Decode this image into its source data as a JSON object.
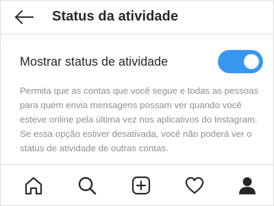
{
  "header": {
    "back_icon": "arrow-left-icon",
    "title": "Status da atividade"
  },
  "setting": {
    "label": "Mostrar status de atividade",
    "enabled": true,
    "toggle_color": "#3897f0",
    "description": "Permita que as contas que você segue e todas as pessoas\npara quem envia mensagens possam ver quando você\nesteve online pela última vez nos aplicativos do Instagram.\nSe essa opção estiver desativada, você não poderá ver o\nstatus de atividade de outras contas."
  },
  "bottom_nav": {
    "items": [
      {
        "icon": "home-icon"
      },
      {
        "icon": "search-icon"
      },
      {
        "icon": "add-post-icon"
      },
      {
        "icon": "heart-icon"
      },
      {
        "icon": "profile-icon"
      }
    ]
  }
}
